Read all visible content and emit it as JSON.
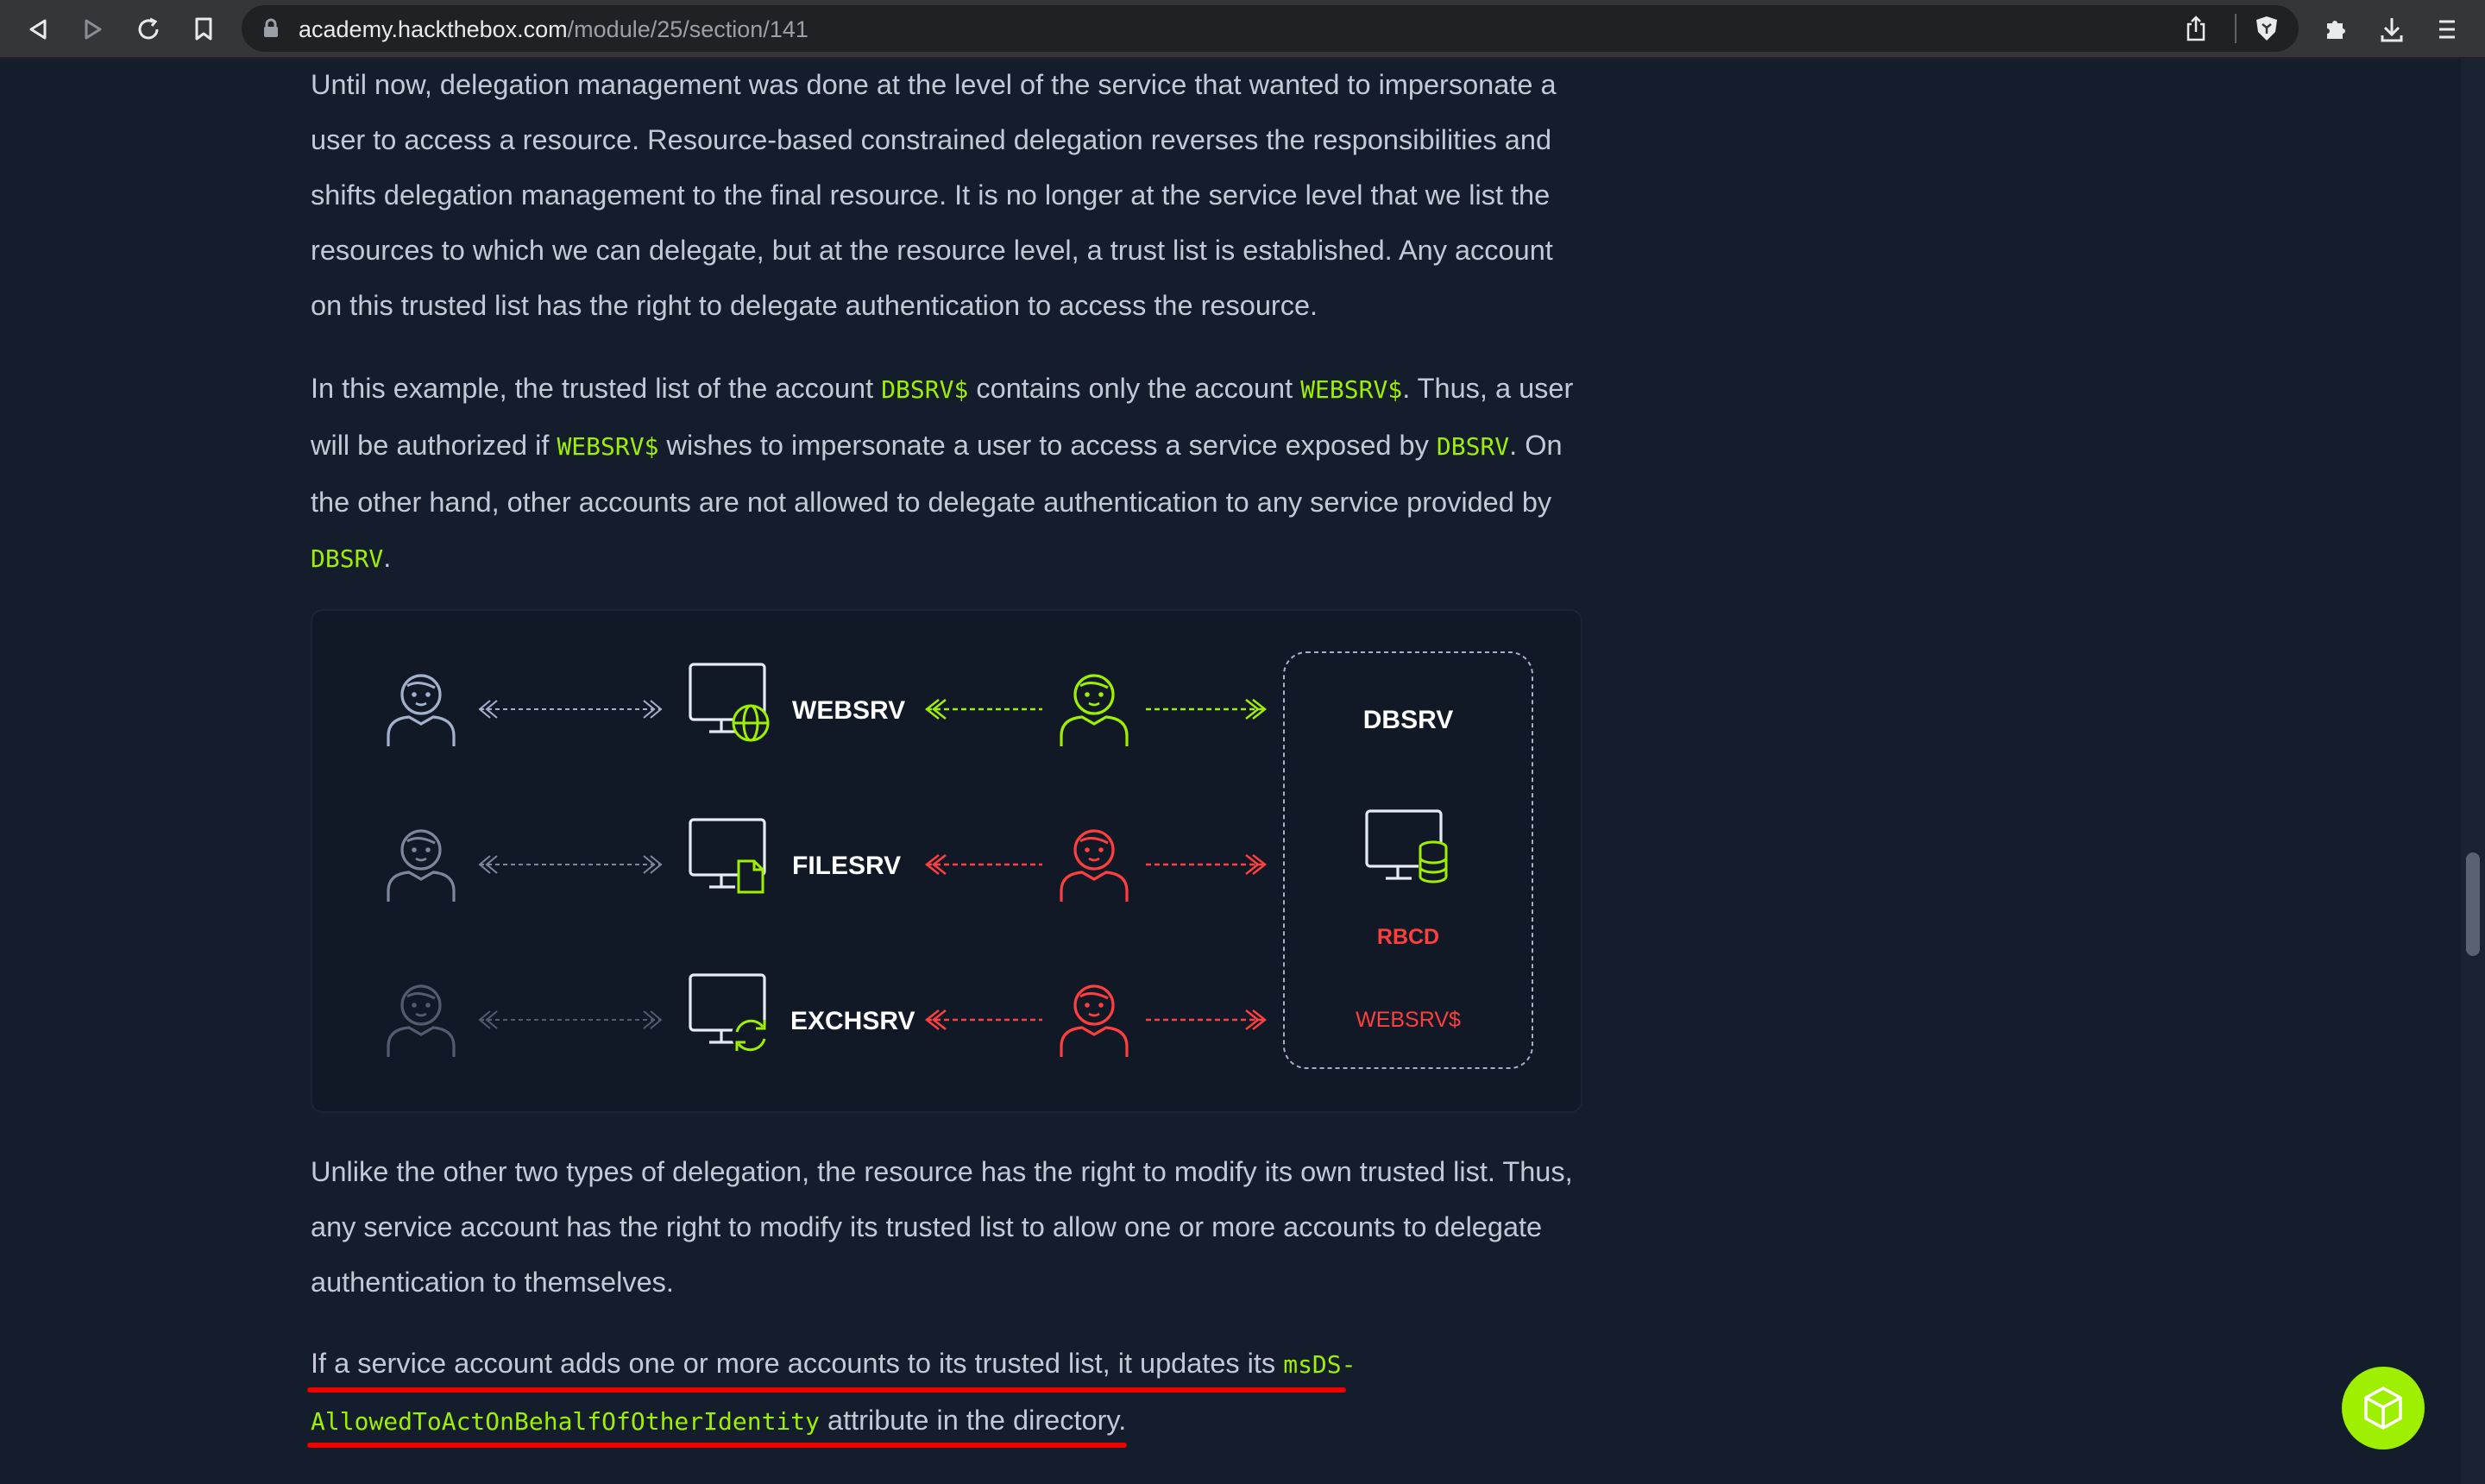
{
  "browser": {
    "url_host": "academy.hackthebox.com",
    "url_path": "/module/25/section/141"
  },
  "content": {
    "para1": "Until now, delegation management was done at the level of the service that wanted to impersonate a user to access a resource. Resource-based constrained delegation reverses the responsibilities and shifts delegation management to the final resource. It is no longer at the service level that we list the resources to which we can delegate, but at the resource level, a trust list is established. Any account on this trusted list has the right to delegate authentication to access the resource.",
    "para2": {
      "t1": "In this example, the trusted list of the account ",
      "c1": "DBSRV$",
      "t2": " contains only the account ",
      "c2": "WEBSRV$",
      "t3": ". Thus, a user will be authorized if ",
      "c3": "WEBSRV$",
      "t4": " wishes to impersonate a user to access a service exposed by ",
      "c4": "DBSRV",
      "t5": ". On the other hand, other accounts are not allowed to delegate authentication to any service provided by ",
      "c5": "DBSRV",
      "t6": "."
    },
    "para3": "Unlike the other two types of delegation, the resource has the right to modify its own trusted list. Thus, any service account has the right to modify its trusted list to allow one or more accounts to delegate authentication to themselves.",
    "para4": {
      "t1": "If a service account adds one or more accounts to its trusted list, it updates its ",
      "c1a": "msDS-",
      "c1b": "AllowedToActOnBehalfOfOtherIdentity",
      "t2": " attribute in the directory."
    }
  },
  "diagram": {
    "services": [
      "WEBSRV",
      "FILESRV",
      "EXCHSRV"
    ],
    "resource": "DBSRV",
    "resource_label": "RBCD",
    "trusted_account": "WEBSRV$",
    "colors": {
      "allowed": "#9fef00",
      "denied": "#ff3e3e",
      "neutral": "#a4b1cd"
    }
  }
}
